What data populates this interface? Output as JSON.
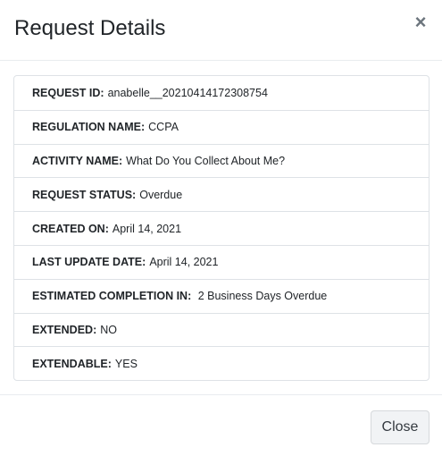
{
  "modal": {
    "title": "Request Details",
    "close_icon": "×",
    "footer": {
      "close_label": "Close"
    }
  },
  "details": [
    {
      "label": "REQUEST ID:",
      "value": "anabelle__20210414172308754"
    },
    {
      "label": "REGULATION NAME:",
      "value": "CCPA"
    },
    {
      "label": "ACTIVITY NAME:",
      "value": "What Do You Collect About Me?"
    },
    {
      "label": "REQUEST STATUS:",
      "value": "Overdue"
    },
    {
      "label": "CREATED ON:",
      "value": "April 14, 2021"
    },
    {
      "label": "LAST UPDATE DATE:",
      "value": "April 14, 2021"
    },
    {
      "label": "ESTIMATED COMPLETION IN:",
      "value": " 2 Business Days Overdue"
    },
    {
      "label": "EXTENDED:",
      "value": "NO"
    },
    {
      "label": "EXTENDABLE:",
      "value": "YES"
    }
  ]
}
